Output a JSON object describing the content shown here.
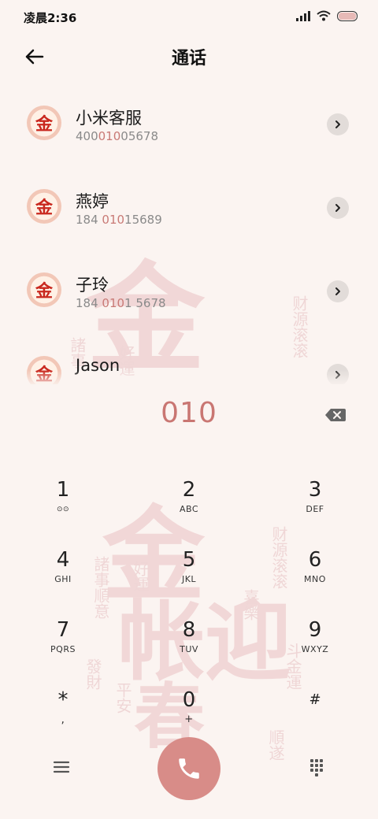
{
  "status_bar": {
    "time": "凌晨2:36"
  },
  "header": {
    "title": "通话"
  },
  "contacts": [
    {
      "name": "小米客服",
      "number_pre": "400",
      "number_hl": "010",
      "number_post": "05678"
    },
    {
      "name": "燕婷",
      "number_pre": "184 ",
      "number_hl": "010",
      "number_post": "15689"
    },
    {
      "name": "子玲",
      "number_pre": "184 ",
      "number_hl": "010",
      "number_post": "1 5678"
    },
    {
      "name": "Jason",
      "number_pre": "",
      "number_hl": "",
      "number_post": ""
    }
  ],
  "dialer": {
    "digits": "010"
  },
  "keypad": [
    {
      "num": "1",
      "sub": "⊙⊙"
    },
    {
      "num": "2",
      "sub": "ABC"
    },
    {
      "num": "3",
      "sub": "DEF"
    },
    {
      "num": "4",
      "sub": "GHI"
    },
    {
      "num": "5",
      "sub": "JKL"
    },
    {
      "num": "6",
      "sub": "MNO"
    },
    {
      "num": "7",
      "sub": "PQRS"
    },
    {
      "num": "8",
      "sub": "TUV"
    },
    {
      "num": "9",
      "sub": "WXYZ"
    },
    {
      "num": "*",
      "sub": ","
    },
    {
      "num": "0",
      "sub": "+"
    },
    {
      "num": "#",
      "sub": ""
    }
  ],
  "icons": {
    "back": "back-arrow-icon",
    "chevron": "chevron-right-icon",
    "delete": "backspace-icon",
    "menu": "menu-icon",
    "call": "phone-icon",
    "dialpad": "dialpad-icon"
  },
  "colors": {
    "accent": "#c97672",
    "call_button": "#d88c88",
    "background": "#fbf4f1"
  }
}
